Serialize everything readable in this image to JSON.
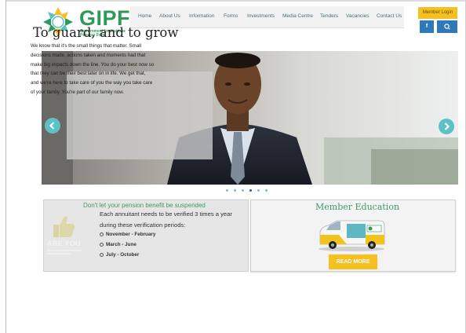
{
  "logo": {
    "word": "GIPF",
    "sub_line1": "Government Institutions",
    "sub_line2": "Pension Fund",
    "colors": {
      "green": "#2e9a59",
      "gold": "#f6c021",
      "teal": "#5cc1c9",
      "blue": "#2f79b9"
    }
  },
  "nav": {
    "items": [
      "Home",
      "About Us",
      "Information",
      "Forms",
      "Investments",
      "Media Centre",
      "Tenders",
      "Vacancies",
      "Contact Us"
    ]
  },
  "header_actions": {
    "login_label": "Member Login",
    "facebook_label": "f",
    "search_icon": "search-icon"
  },
  "hero": {
    "title": "To guard, and to grow",
    "lines": [
      "We know that it's the small things that matter. Small",
      "decisions made, actions taken and moments had that",
      "make big impacts down the line. You do your best now so",
      "that they can be their best later on in life. We get that,",
      "and we're here to take care of you the way you take care",
      "of your family. You're part of our family now."
    ],
    "prev_icon": "chevron-left-icon",
    "next_icon": "chevron-right-icon",
    "slide_count": 6,
    "active_slide": 4
  },
  "verification": {
    "heading": "Don't let your pension benefit be suspended",
    "line1": "Each annuitant needs to be verified 3 times a year",
    "line2": "during these verification periods:",
    "periods": [
      "November - February",
      "March - June",
      "July - October"
    ],
    "badge_text": "ARE YOU"
  },
  "education": {
    "title": "Member Education",
    "button_label": "READ MORE"
  }
}
